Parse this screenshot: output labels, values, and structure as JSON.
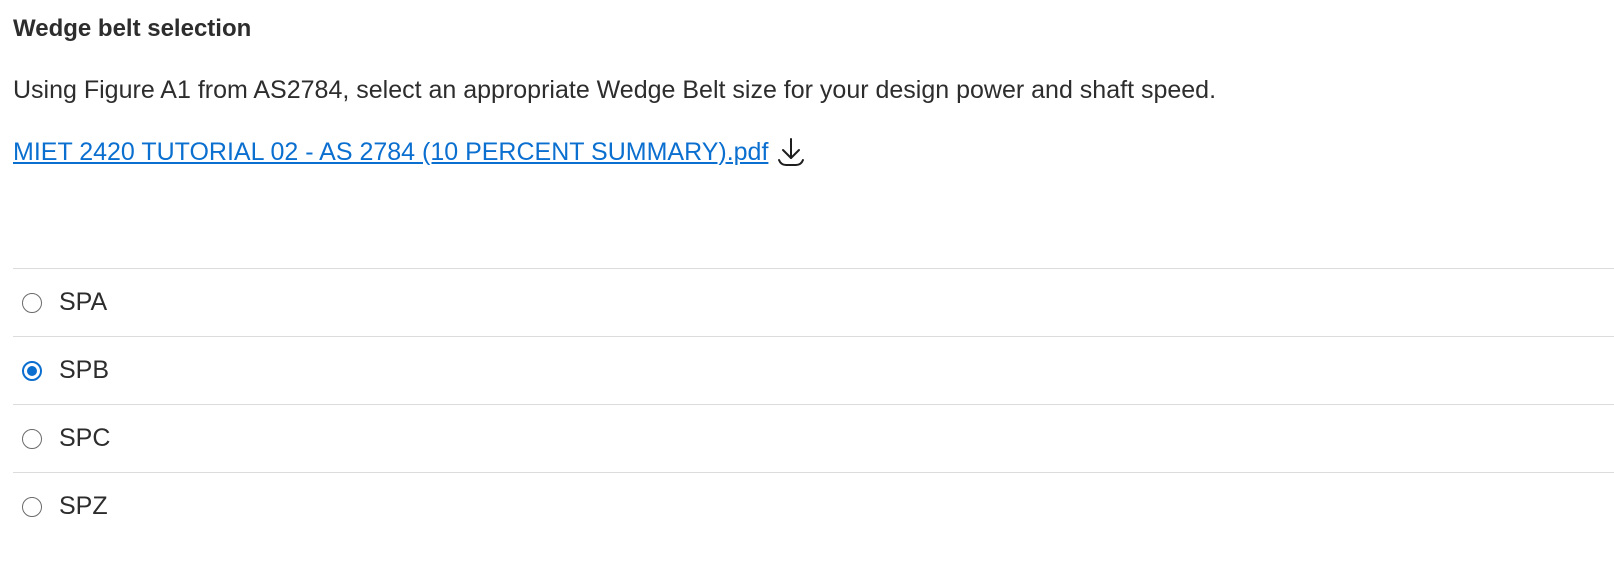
{
  "question": {
    "title": "Wedge belt selection",
    "prompt": "Using Figure A1 from AS2784, select an appropriate Wedge Belt size for your design power and shaft speed.",
    "attachment": {
      "file_name": "MIET 2420 TUTORIAL 02 - AS 2784 (10 PERCENT SUMMARY).pdf",
      "icon": "download-icon"
    },
    "options": [
      {
        "label": "SPA",
        "selected": false
      },
      {
        "label": "SPB",
        "selected": true
      },
      {
        "label": "SPC",
        "selected": false
      },
      {
        "label": "SPZ",
        "selected": false
      }
    ]
  },
  "colors": {
    "link": "#0b6fd0",
    "radio_selected": "#0b6fd0",
    "text": "#2d2d2d",
    "divider": "#dcdcdc"
  }
}
